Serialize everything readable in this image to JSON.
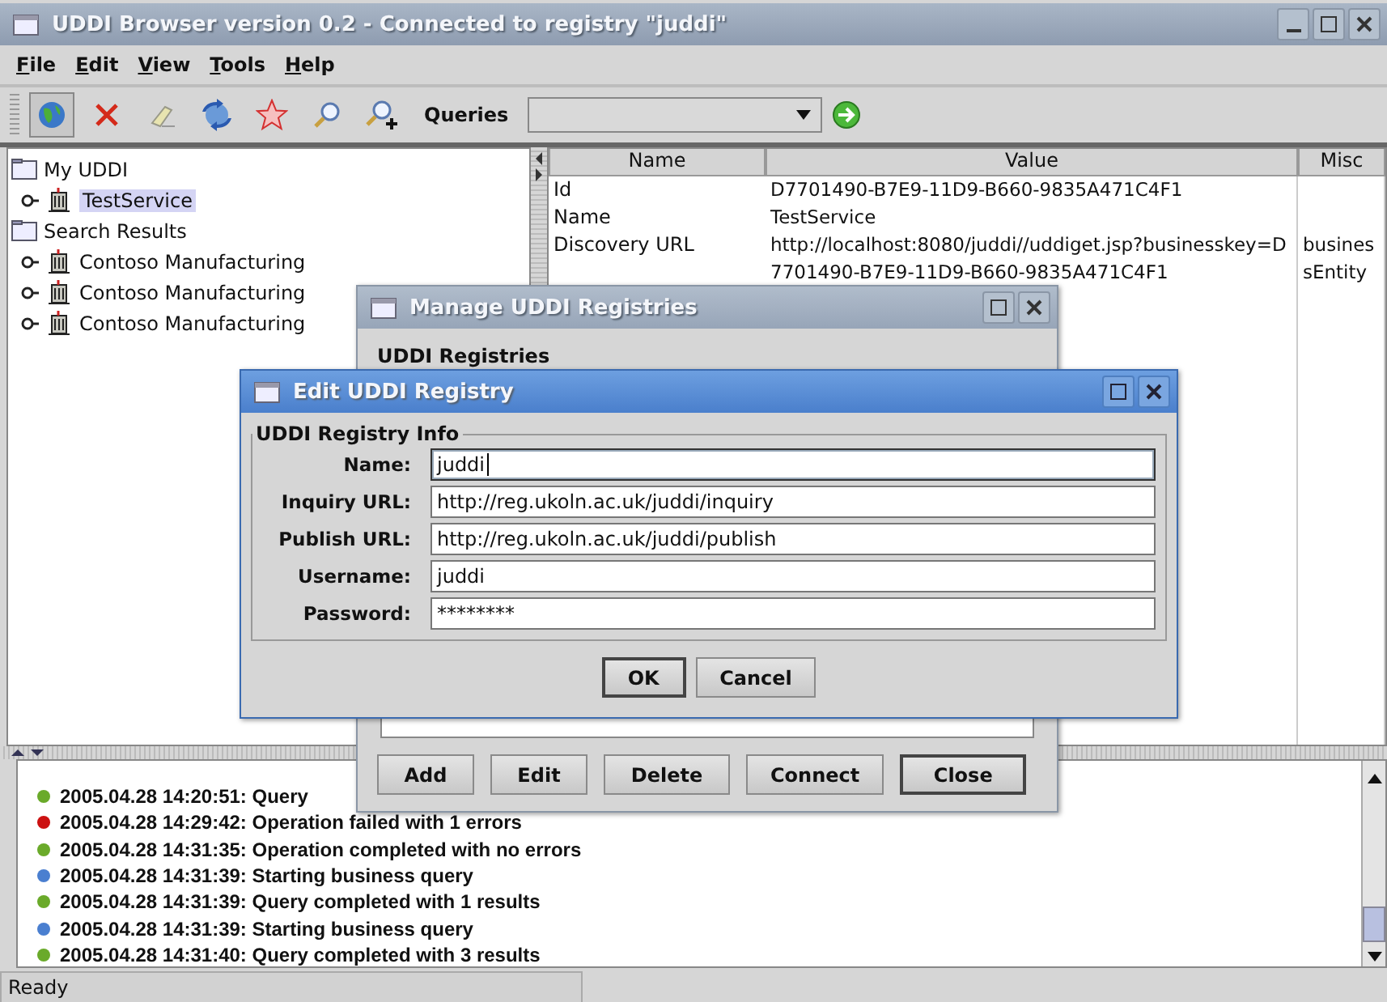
{
  "window": {
    "title": "UDDI Browser version 0.2 - Connected to registry \"juddi\""
  },
  "menu": [
    "File",
    "Edit",
    "View",
    "Tools",
    "Help"
  ],
  "toolbar": {
    "tools": [
      {
        "kind": "globe",
        "pressed": true
      },
      {
        "kind": "delete",
        "pressed": false
      },
      {
        "kind": "eraser",
        "pressed": false
      },
      {
        "kind": "refresh",
        "pressed": false
      },
      {
        "kind": "star",
        "pressed": false
      },
      {
        "kind": "search",
        "pressed": false
      },
      {
        "kind": "search-plus",
        "pressed": false
      }
    ],
    "queries_label": "Queries"
  },
  "tree": [
    {
      "label": "My UDDI",
      "kind": "folder",
      "selected": false,
      "children": [
        {
          "label": "TestService",
          "kind": "business",
          "selected": true
        }
      ]
    },
    {
      "label": "Search Results",
      "kind": "folder",
      "selected": false,
      "children": [
        {
          "label": "Contoso Manufacturing",
          "kind": "business",
          "selected": false
        },
        {
          "label": "Contoso Manufacturing",
          "kind": "business",
          "selected": false
        },
        {
          "label": "Contoso Manufacturing",
          "kind": "business",
          "selected": false
        }
      ]
    }
  ],
  "table": {
    "columns": [
      "Name",
      "Value",
      "Misc"
    ],
    "rows": [
      {
        "name": "Id",
        "value": "D7701490-B7E9-11D9-B660-9835A471C4F1",
        "misc": ""
      },
      {
        "name": "Name",
        "value": "TestService",
        "misc": ""
      },
      {
        "name": "Discovery URL",
        "value": "http://localhost:8080/juddi//uddiget.jsp?businesskey=D7701490-B7E9-11D9-B660-9835A471C4F1",
        "misc": "businessEntity"
      }
    ]
  },
  "log": [
    {
      "text": "2005.04.28 14:20:51: Query",
      "color": "#6aaa2a"
    },
    {
      "text": "2005.04.28 14:29:42: Operation failed with 1 errors",
      "color": "#cc1111"
    },
    {
      "text": "2005.04.28 14:31:35: Operation completed with no errors",
      "color": "#6aaa2a"
    },
    {
      "text": "2005.04.28 14:31:39: Starting business query",
      "color": "#4a7fd0"
    },
    {
      "text": "2005.04.28 14:31:39: Query completed with 1 results",
      "color": "#6aaa2a"
    },
    {
      "text": "2005.04.28 14:31:39: Starting business query",
      "color": "#4a7fd0"
    },
    {
      "text": "2005.04.28 14:31:40: Query completed with 3 results",
      "color": "#6aaa2a"
    }
  ],
  "status_bar": {
    "text": "Ready"
  },
  "manage_dialog": {
    "title": "Manage UDDI Registries",
    "heading": "UDDI Registries",
    "buttons": [
      {
        "label": "Add",
        "default": false
      },
      {
        "label": "Edit",
        "default": false
      },
      {
        "label": "Delete",
        "default": false
      },
      {
        "label": "Connect",
        "default": false
      },
      {
        "label": "Close",
        "default": true
      }
    ]
  },
  "edit_dialog": {
    "title": "Edit UDDI Registry",
    "group": "UDDI Registry Info",
    "fields": [
      {
        "label": "Name:",
        "value": "juddi",
        "focused": true
      },
      {
        "label": "Inquiry URL:",
        "value": "http://reg.ukoln.ac.uk/juddi/inquiry",
        "focused": false
      },
      {
        "label": "Publish URL:",
        "value": "http://reg.ukoln.ac.uk/juddi/publish",
        "focused": false
      },
      {
        "label": "Username:",
        "value": "juddi",
        "focused": false
      },
      {
        "label": "Password:",
        "value": "********",
        "focused": false
      }
    ],
    "buttons": [
      {
        "label": "OK",
        "default": true
      },
      {
        "label": "Cancel",
        "default": false
      }
    ]
  }
}
